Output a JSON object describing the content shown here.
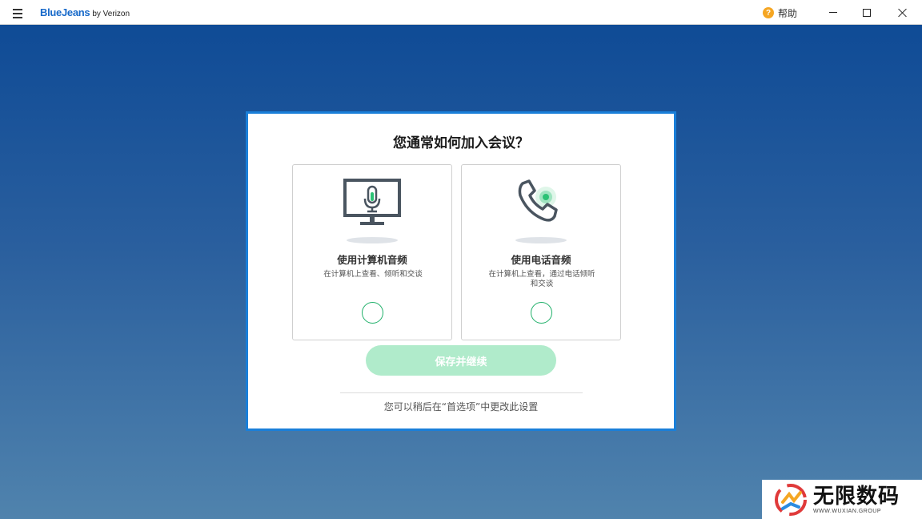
{
  "titlebar": {
    "brand": "BlueJeans",
    "brand_by": "by Verizon",
    "help_label": "帮助",
    "help_icon": "?"
  },
  "dialog": {
    "title": "您通常如何加入会议？",
    "options": [
      {
        "label": "使用计算机音频",
        "description": "在计算机上查看、倾听和交谈",
        "icon": "monitor-microphone-icon",
        "selected": false
      },
      {
        "label": "使用电话音频",
        "description": "在计算机上查看，通过电话倾听和交谈",
        "icon": "phone-icon",
        "selected": false
      }
    ],
    "save_label": "保存并继续",
    "footnote": "您可以稍后在“首选项”中更改此设置"
  },
  "colors": {
    "accent_green": "#20b06a",
    "disabled_button": "#b0ebcb",
    "dialog_border": "#1a7fd9",
    "brand_blue": "#1769c9"
  },
  "watermark": {
    "main": "无限数码",
    "sub": "WWW.WUXIAN.GROUP"
  }
}
